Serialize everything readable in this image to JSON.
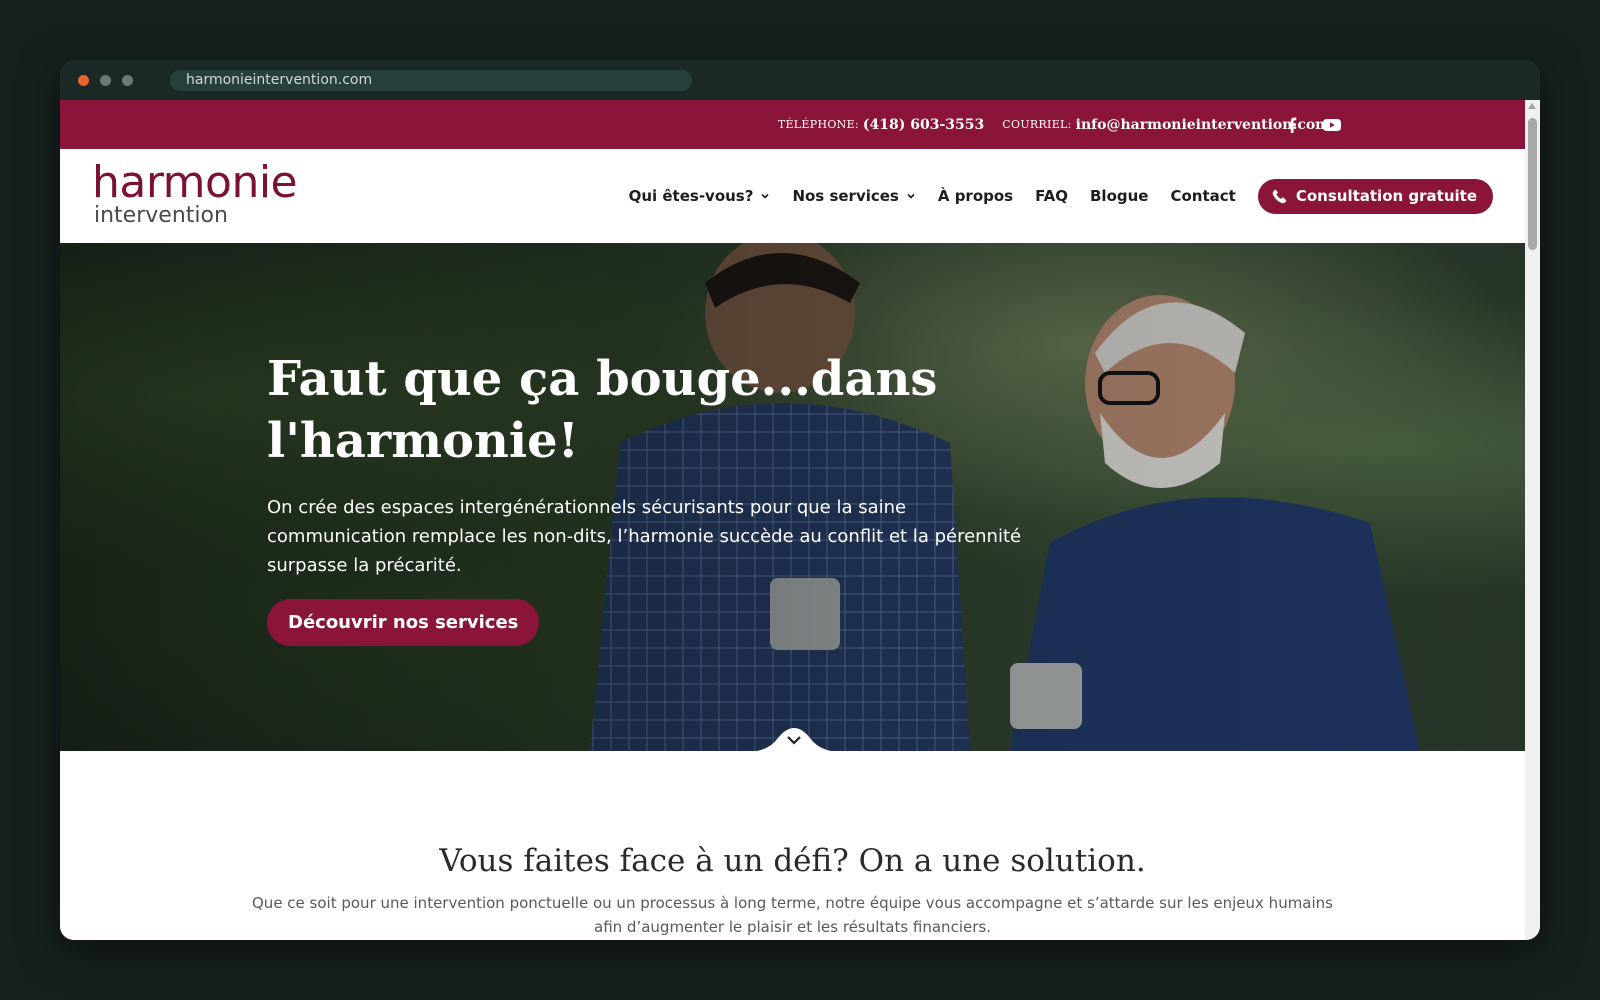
{
  "browser": {
    "url": "harmonieintervention.com",
    "dots": [
      "#e8652f",
      "#6c7a76",
      "#6c7a76"
    ]
  },
  "topbar": {
    "phone_label": "TÉLÉPHONE:",
    "phone_value": "(418) 603-3553",
    "email_label": "COURRIEL:",
    "email_value": "info@harmonieintervention.com",
    "social_icons": [
      "facebook-icon",
      "youtube-icon"
    ]
  },
  "logo": {
    "line1": "harmonie",
    "line2": "intervention"
  },
  "nav": {
    "items": [
      {
        "label": "Qui êtes-vous?",
        "dropdown": true
      },
      {
        "label": "Nos services",
        "dropdown": true
      },
      {
        "label": "À propos",
        "dropdown": false
      },
      {
        "label": "FAQ",
        "dropdown": false
      },
      {
        "label": "Blogue",
        "dropdown": false
      },
      {
        "label": "Contact",
        "dropdown": false
      }
    ],
    "cta_label": "Consultation gratuite"
  },
  "hero": {
    "title": "Faut que ça bouge...dans l'harmonie!",
    "text": "On crée des espaces intergénérationnels sécurisants pour que la saine communication remplace les non-dits, l’harmonie succède au conflit et la pérennité surpasse la précarité.",
    "button_label": "Découvrir nos services"
  },
  "section": {
    "title": "Vous faites face à un défi? On a une solution.",
    "text": "Que ce soit pour une intervention ponctuelle ou un processus à long terme, notre équipe vous accompagne et s’attarde sur les enjeux humains afin d’augmenter le plaisir et les résultats financiers."
  },
  "colors": {
    "brand": "#8a1538",
    "topbar_bg": "#8a1538",
    "window_bg": "#1b2a27",
    "page_bg": "#16211f"
  }
}
